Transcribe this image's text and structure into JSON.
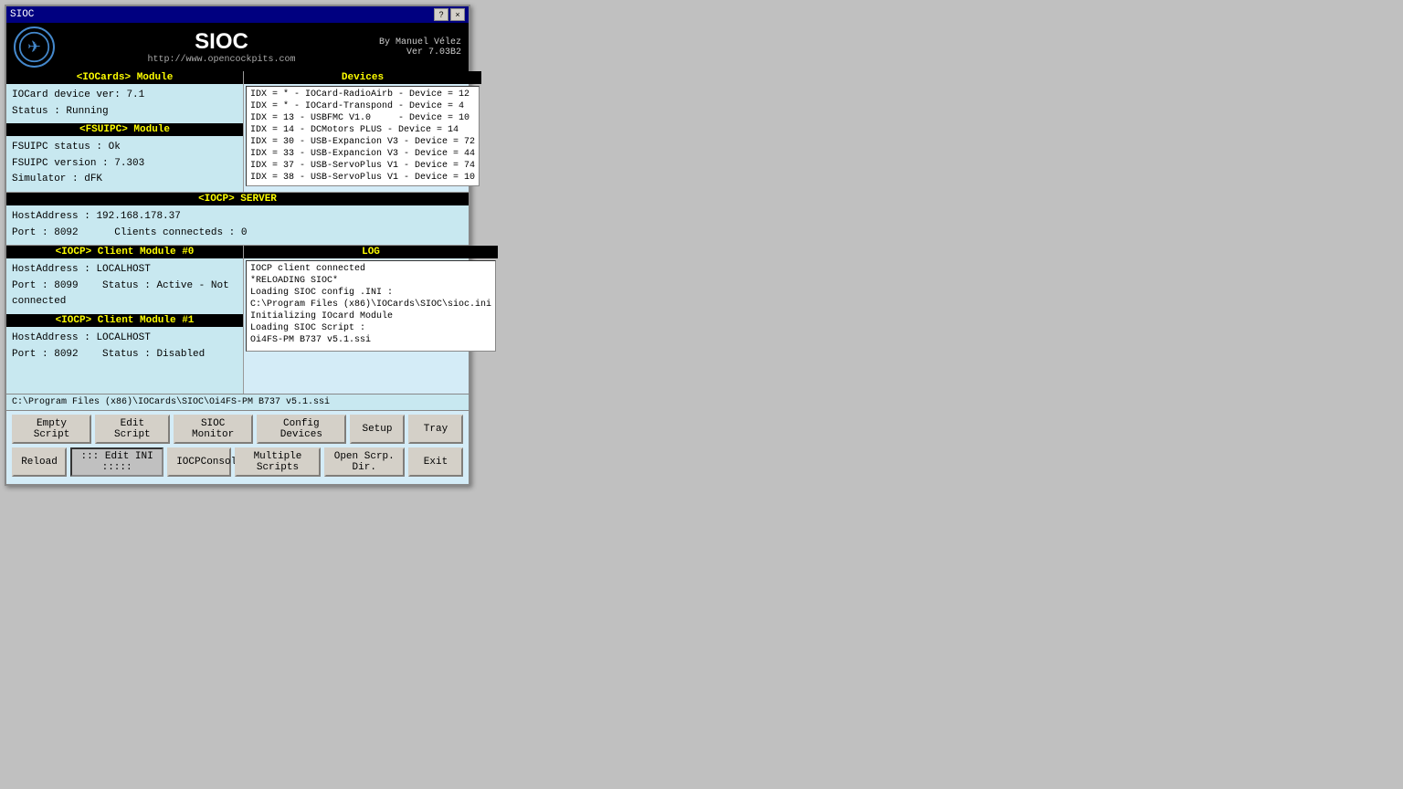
{
  "window": {
    "title": "SIOC",
    "help_label": "?",
    "close_label": "×"
  },
  "header": {
    "app_name": "SIOC",
    "website": "http://www.opencockpits.com",
    "author": "By Manuel Vélez",
    "version": "Ver 7.03B2"
  },
  "iocards_module": {
    "label": "<IOCards> Module",
    "device_ver_label": "IOCard device ver:",
    "device_ver_value": "7.1",
    "status_label": "Status :",
    "status_value": "Running"
  },
  "fsuipc_module": {
    "label": "<FSUIPC> Module",
    "status_label": "FSUIPC status :",
    "status_value": "Ok",
    "version_label": "FSUIPC version :",
    "version_value": "7.303",
    "simulator_label": "Simulator :",
    "simulator_value": "dFK"
  },
  "devices_section": {
    "label": "Devices",
    "items": [
      "IDX = * - IOCard-RadioAirb - Device = 12",
      "IDX = * - IOCard-Transpond - Device = 4",
      "IDX = 13 - USBFMC V1.0     - Device = 10",
      "IDX = 14 - DCMotors PLUS - Device = 14",
      "IDX = 30 - USB-Expancion V3 - Device = 72",
      "IDX = 33 - USB-Expancion V3 - Device = 44",
      "IDX = 37 - USB-ServoPlus V1 - Device = 74",
      "IDX = 38 - USB-ServoPlus V1 - Device = 10"
    ]
  },
  "iocp_server": {
    "label": "<IOCP> SERVER",
    "host_label": "HostAddress :",
    "host_value": "192.168.178.37",
    "port_label": "Port :",
    "port_value": "8092",
    "clients_label": "Clients connecteds :",
    "clients_value": "0"
  },
  "log_section": {
    "label": "LOG",
    "items": [
      "IOCP client connected",
      "*RELOADING SIOC*",
      "Loading SIOC config .INI :",
      "C:\\Program Files (x86)\\IOCards\\SIOC\\sioc.ini",
      "Initializing IOcard Module",
      "Loading SIOC Script :",
      "Oi4FS-PM B737 v5.1.ssi"
    ]
  },
  "iocp_client_0": {
    "label": "<IOCP> Client Module #0",
    "host_label": "HostAddress :",
    "host_value": "LOCALHOST",
    "port_label": "Port :",
    "port_value": "8099",
    "status_label": "Status :",
    "status_value": "Active - Not connected"
  },
  "iocp_client_1": {
    "label": "<IOCP> Client Module #1",
    "host_label": "HostAddress :",
    "host_value": "LOCALHOST",
    "port_label": "Port :",
    "port_value": "8092",
    "status_label": "Status :",
    "status_value": "Disabled"
  },
  "file_path": {
    "value": "C:\\Program Files (x86)\\IOCards\\SIOC\\Oi4FS-PM B737 v5.1.ssi"
  },
  "buttons_row1": {
    "empty_script": "Empty Script",
    "edit_script": "Edit Script",
    "sioc_monitor": "SIOC Monitor",
    "config_devices": "Config Devices",
    "setup": "Setup",
    "tray": "Tray"
  },
  "buttons_row2": {
    "reload": "Reload",
    "edit_ini": "::: Edit INI :::::",
    "iocp_console": "IOCPConsole",
    "multiple_scripts": "Multiple Scripts",
    "open_scrp_dir": "Open Scrp. Dir.",
    "exit": "Exit"
  }
}
